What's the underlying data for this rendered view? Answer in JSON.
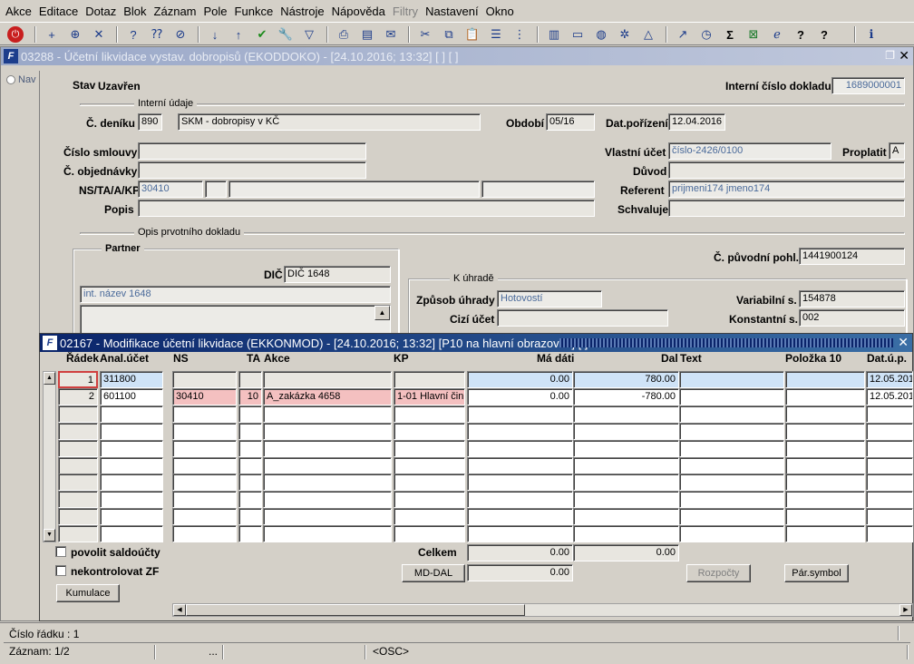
{
  "menu": [
    "Akce",
    "Editace",
    "Dotaz",
    "Blok",
    "Záznam",
    "Pole",
    "Funkce",
    "Nástroje",
    "Nápověda",
    "Filtry",
    "Nastavení",
    "Okno"
  ],
  "menu_disabled": [
    "Filtry"
  ],
  "toolbar_icons": [
    "exit-icon",
    "add-row-icon",
    "insert-icon",
    "delete-row-icon",
    "query-icon",
    "query-run-icon",
    "query-cancel-icon",
    "sort-asc-icon",
    "sort-desc-icon",
    "commit-icon",
    "tools-icon",
    "filter-icon",
    "print-icon",
    "print-preview-icon",
    "mail-icon",
    "cut-icon",
    "copy-icon",
    "paste-icon",
    "list-icon",
    "tree-icon",
    "document-icon",
    "save-icon",
    "globe-icon",
    "settings-icon",
    "help-triangle-icon",
    "chart-icon",
    "clock-icon",
    "sum-icon",
    "excel-icon",
    "ie-icon",
    "help-icon",
    "context-help-icon",
    "info-icon"
  ],
  "main_window": {
    "title": "03288 - Účetní likvidace vystav. dobropisů (EKODDOKO) - [24.10.2016; 13:32]  [ ]  [ ]",
    "nav_label": "Nav",
    "stav_label": "Stav",
    "stav_value": "Uzavřen",
    "interni_cislo_label": "Interní číslo dokladu",
    "interni_cislo_value": "1689000001",
    "interni_udaje_group": "Interní údaje",
    "cislo_deniku_label": "Č. deníku",
    "cislo_deniku_value": "890",
    "denik_name": "SKM - dobropisy v KČ",
    "obdobi_label": "Období",
    "obdobi_value": "05/16",
    "datporizeni_label": "Dat.pořízení",
    "datporizeni_value": "12.04.2016",
    "cislo_smlouvy_label": "Číslo smlouvy",
    "cislo_smlouvy_value": "",
    "vlastni_ucet_label": "Vlastní účet",
    "vlastni_ucet_value": "číslo-2426/0100",
    "proplatit_label": "Proplatit",
    "proplatit_value": "A",
    "cislo_objednavky_label": "Č. objednávky",
    "cislo_objednavky_value": "",
    "duvod_label": "Důvod",
    "duvod_value": "",
    "nstaakp_label": "NS/TA/A/KP",
    "ns_value": "30410",
    "referent_label": "Referent",
    "referent_value": "prijmeni174 jmeno174",
    "popis_label": "Popis",
    "popis_value": "",
    "schvaluje_label": "Schvaluje",
    "schvaluje_value": "",
    "opis_group": "Opis prvotního dokladu",
    "partner_group": "Partner",
    "dic_label": "DIČ",
    "dic_value": "DIČ 1648",
    "int_nazev_value": "int. název 1648",
    "puvodni_pohl_label": "Č. původní pohl.",
    "puvodni_pohl_value": "1441900124",
    "k_uhrade_group": "K úhradě",
    "zpusob_uhrady_label": "Způsob úhrady",
    "zpusob_uhrady_value": "Hotovostí",
    "variabilni_label": "Variabilní s.",
    "variabilni_value": "154878",
    "cizi_ucet_label": "Cizí účet",
    "cizi_ucet_value": "",
    "konstantni_label": "Konstantní s.",
    "konstantni_value": "002"
  },
  "modal": {
    "title": "02167 - Modifikace účetní likvidace (EKKONMOD) - [24.10.2016; 13:32]  [P10 na hlavní obrazovku]  [ ]",
    "columns": {
      "radek": "Řádek",
      "anal": "Anal.účet",
      "ns": "NS",
      "ta": "TA",
      "akce": "Akce",
      "kp": "KP",
      "ma_dati": "Má dáti",
      "dal": "Dal",
      "text": "Text",
      "polozka": "Položka 10",
      "dat": "Dat.ú.p."
    },
    "rows": [
      {
        "radek": "1",
        "anal": "311800",
        "ns": "",
        "ta": "",
        "akce": "",
        "kp": "",
        "ma_dati": "0.00",
        "dal": "780.00",
        "text": "",
        "polozka": "",
        "dat": "12.05.201"
      },
      {
        "radek": "2",
        "anal": "601100",
        "ns": "30410",
        "ta": "10",
        "akce": "A_zakázka 4658",
        "kp": "1-01 Hlavní činn",
        "ma_dati": "0.00",
        "dal": "-780.00",
        "text": "",
        "polozka": "",
        "dat": "12.05.201"
      }
    ],
    "povolit_saldoucty": "povolit saldoúčty",
    "nekontrolovat_zf": "nekontrolovat ZF",
    "celkem_label": "Celkem",
    "celkem_ma_dati": "0.00",
    "celkem_dal": "0.00",
    "md_dal_button": "MD-DAL",
    "md_dal_value": "0.00",
    "rozpocty_button": "Rozpočty",
    "par_symbol_button": "Pár.symbol",
    "kumulace_button": "Kumulace"
  },
  "status": {
    "cislo_radku": "Číslo řádku : 1",
    "zaznam": "Záznam: 1/2",
    "dots": "...",
    "osc": "<OSC>"
  }
}
